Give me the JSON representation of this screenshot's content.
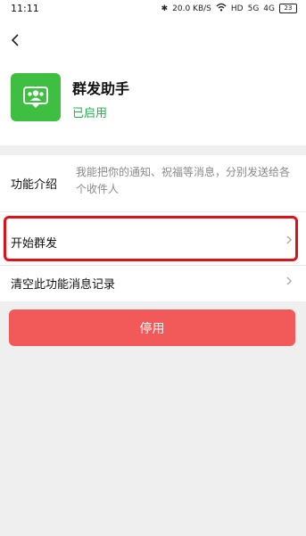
{
  "status_bar": {
    "time": "11:11",
    "icons": {
      "bluetooth": "bluetooth-icon",
      "network_speed": "20.0 KB/S",
      "wifi": "wifi-icon",
      "hd": "HD",
      "signal_1": "5G",
      "signal_2": "4G",
      "battery": "23"
    }
  },
  "header": {
    "back_icon": "chevron-left-icon"
  },
  "app": {
    "name": "群发助手",
    "status": "已启用",
    "icon": "group-users-icon",
    "icon_color": "#3fbf42",
    "status_color": "#21b04b"
  },
  "rows": {
    "intro_label": "功能介绍",
    "intro_text": "我能把你的通知、祝福等消息，分别发送给各个收件人",
    "start_label": "开始群发",
    "clear_label": "清空此功能消息记录",
    "chevron_icon": "chevron-right-icon"
  },
  "buttons": {
    "disable_label": "停用",
    "disable_color": "#f25a5a"
  },
  "highlight_color": "#e01018"
}
